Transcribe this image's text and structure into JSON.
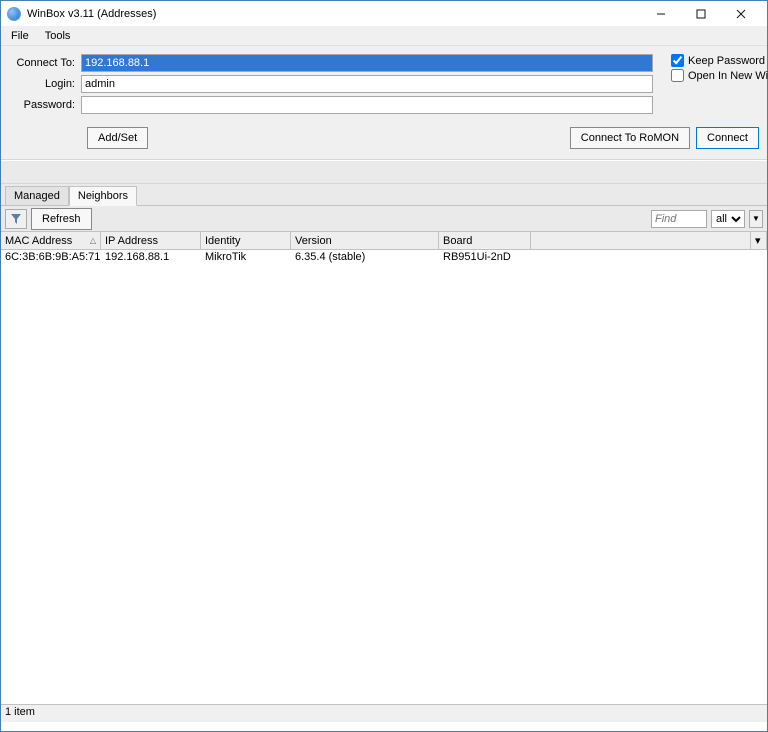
{
  "window": {
    "title": "WinBox v3.11 (Addresses)"
  },
  "menu": {
    "file": "File",
    "tools": "Tools"
  },
  "form": {
    "connect_to_label": "Connect To:",
    "connect_to_value": "192.168.88.1",
    "login_label": "Login:",
    "login_value": "admin",
    "password_label": "Password:",
    "password_value": "",
    "keep_password": "Keep Password",
    "open_new_window": "Open In New Window",
    "add_set": "Add/Set",
    "connect_romon": "Connect To RoMON",
    "connect": "Connect"
  },
  "tabs": {
    "managed": "Managed",
    "neighbors": "Neighbors"
  },
  "toolbar": {
    "refresh": "Refresh",
    "find_placeholder": "Find",
    "scope_all": "all"
  },
  "columns": {
    "mac": "MAC Address",
    "ip": "IP Address",
    "identity": "Identity",
    "version": "Version",
    "board": "Board"
  },
  "rows": [
    {
      "mac": "6C:3B:6B:9B:A5:71",
      "ip": "192.168.88.1",
      "identity": "MikroTik",
      "version": "6.35.4 (stable)",
      "board": "RB951Ui-2nD"
    }
  ],
  "status": {
    "items": "1 item"
  }
}
